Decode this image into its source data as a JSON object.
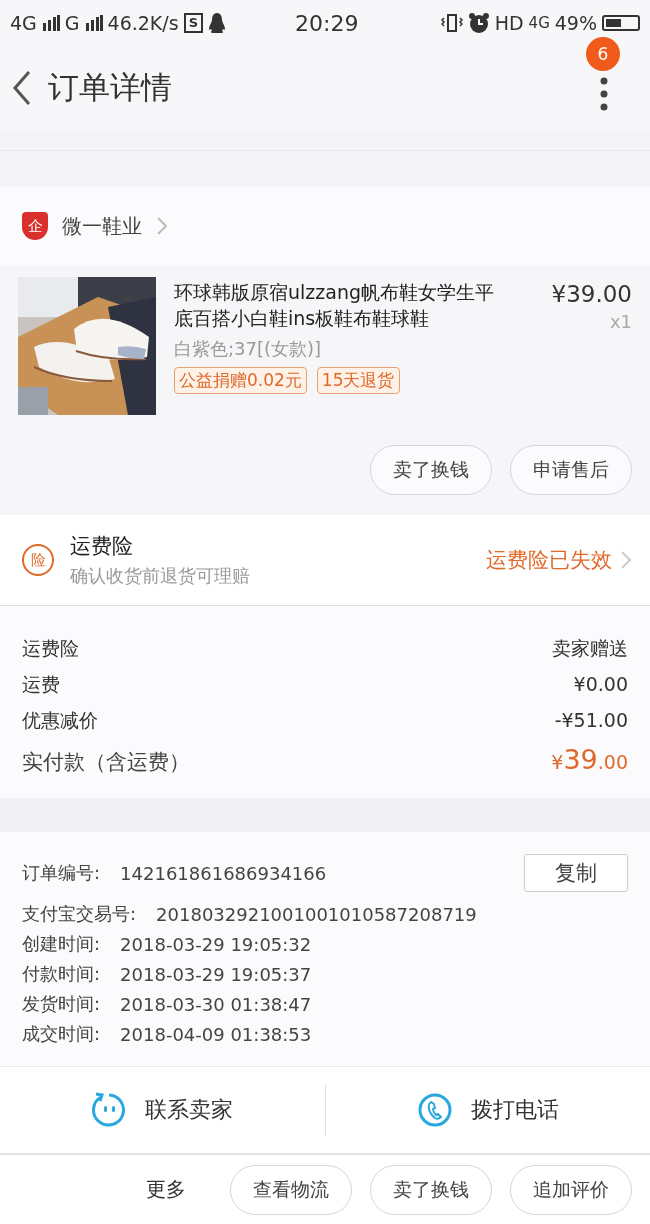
{
  "status_bar": {
    "network_1": "4G",
    "network_2": "G",
    "speed": "46.2K/s",
    "app_badge": "S",
    "time": "20:29",
    "hd": "HD",
    "network_3": "4G",
    "battery": "49%"
  },
  "nav": {
    "title": "订单详情",
    "badge": "6"
  },
  "shop": {
    "badge": "企",
    "name": "微一鞋业"
  },
  "product": {
    "title": "环球韩版原宿ulzzang帆布鞋女学生平底百搭小白鞋ins板鞋布鞋球鞋",
    "price": "¥39.00",
    "quantity": "x1",
    "variant": "白紫色;37[(女款)]",
    "tags": [
      "公益捐赠0.02元",
      "15天退货"
    ],
    "actions": [
      "卖了换钱",
      "申请售后"
    ]
  },
  "insurance": {
    "icon": "险",
    "title": "运费险",
    "subtitle": "确认收货前退货可理赔",
    "status": "运费险已失效"
  },
  "fees": [
    {
      "label": "运费险",
      "value": "卖家赠送"
    },
    {
      "label": "运费",
      "value": "¥0.00"
    },
    {
      "label": "优惠减价",
      "value": "-¥51.00"
    }
  ],
  "total": {
    "label": "实付款（含运费）",
    "currency": "¥",
    "integer": "39",
    "decimal": ".00"
  },
  "order_info": {
    "copy_button": "复制",
    "rows": [
      {
        "label": "订单编号:",
        "value": "142161861686934166"
      },
      {
        "label": "支付宝交易号:",
        "value": "2018032921001001010587208719"
      },
      {
        "label": "创建时间:",
        "value": "2018-03-29 19:05:32"
      },
      {
        "label": "付款时间:",
        "value": "2018-03-29 19:05:37"
      },
      {
        "label": "发货时间:",
        "value": "2018-03-30 01:38:47"
      },
      {
        "label": "成交时间:",
        "value": "2018-04-09 01:38:53"
      }
    ]
  },
  "contact": [
    {
      "kind": "chat",
      "label": "联系卖家"
    },
    {
      "kind": "phone",
      "label": "拨打电话"
    }
  ],
  "bottom_bar": {
    "more": "更多",
    "buttons": [
      "查看物流",
      "卖了换钱",
      "追加评价"
    ]
  }
}
